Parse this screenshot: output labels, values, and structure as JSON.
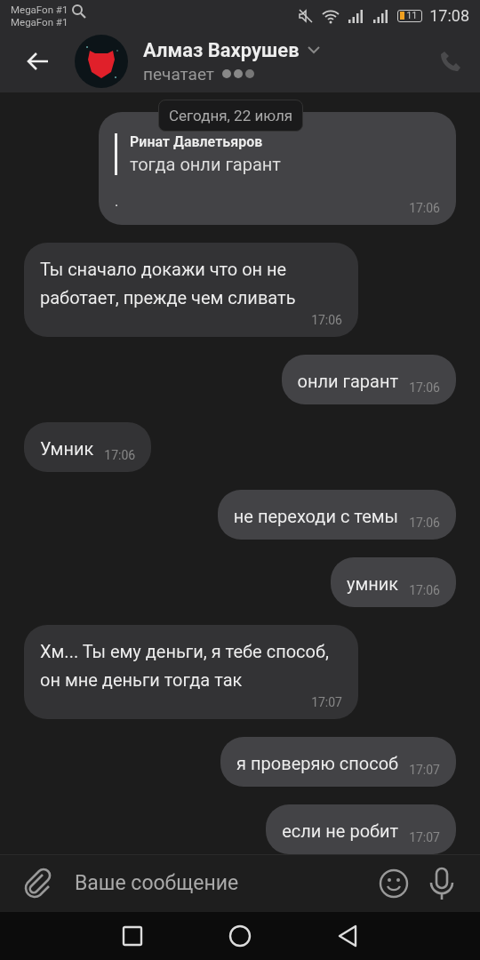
{
  "status_bar": {
    "carriers": [
      "MegaFon #1",
      "MegaFon #1"
    ],
    "battery": "11",
    "time": "17:08"
  },
  "header": {
    "name": "Алмаз Вахрушев",
    "status": "печатает"
  },
  "date_label": "Сегодня, 22 июля",
  "messages": [
    {
      "kind": "out",
      "quote_author": "Ринат Давлетьяров",
      "quote_text": "тогда онли гарант",
      "text": ".",
      "time": "17:06"
    },
    {
      "kind": "in",
      "text": "Ты сначало докажи что он не работает, прежде чем сливать",
      "time": "17:06"
    },
    {
      "kind": "out",
      "text": "онли гарант",
      "time": "17:06"
    },
    {
      "kind": "in",
      "text": "Умник",
      "time": "17:06"
    },
    {
      "kind": "out",
      "text": "не переходи с темы",
      "time": "17:06"
    },
    {
      "kind": "out",
      "text": "умник",
      "time": "17:06"
    },
    {
      "kind": "in",
      "text": "Хм... Ты ему деньги, я тебе способ, он мне деньги тогда так",
      "time": "17:07"
    },
    {
      "kind": "out",
      "text": "я проверяю способ",
      "time": "17:07"
    },
    {
      "kind": "out",
      "text": "если не робит",
      "time": "17:07"
    }
  ],
  "composer": {
    "placeholder": "Ваше сообщение"
  }
}
